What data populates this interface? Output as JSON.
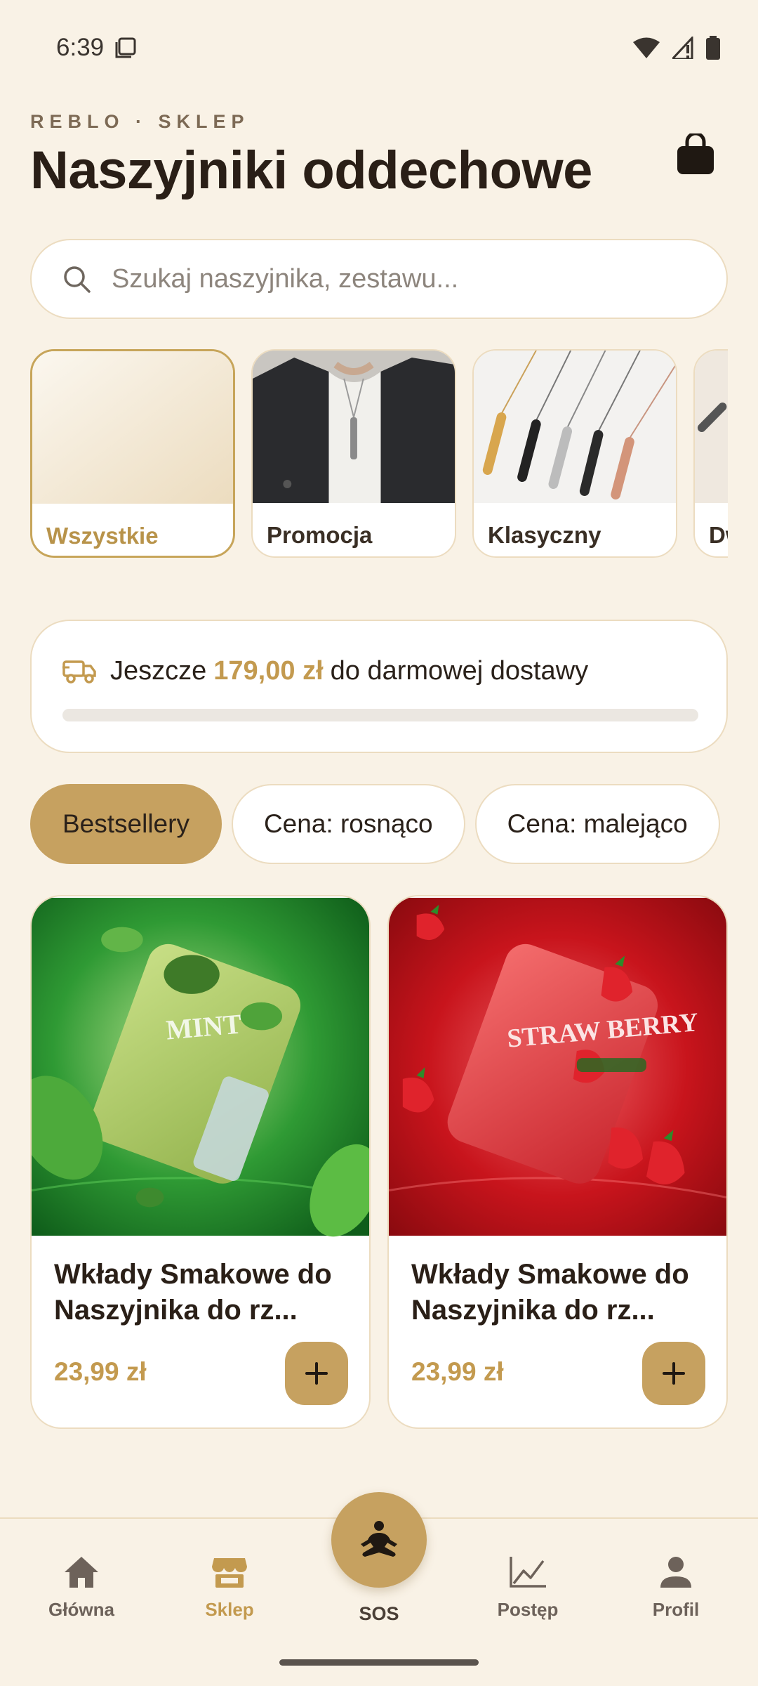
{
  "status_bar": {
    "time": "6:39"
  },
  "header": {
    "overline": "REBLO · SKLEP",
    "title": "Naszyjniki oddechowe"
  },
  "search": {
    "placeholder": "Szukaj naszyjnika, zestawu..."
  },
  "categories": [
    {
      "label": "Wszystkie",
      "active": true
    },
    {
      "label": "Promocja",
      "active": false
    },
    {
      "label": "Klasyczny",
      "active": false
    },
    {
      "label": "Dw",
      "active": false
    }
  ],
  "shipping": {
    "text_before": "Jeszcze",
    "amount": "179,00 zł",
    "text_after": "do darmowej dostawy",
    "progress": 0.0
  },
  "sort_chips": [
    {
      "label": "Bestsellery",
      "active": true
    },
    {
      "label": "Cena: rosnąco",
      "active": false
    },
    {
      "label": "Cena: malejąco",
      "active": false
    }
  ],
  "products": [
    {
      "name": "Wkłady Smakowe do Naszyjnika do rz...",
      "price": "23,99 zł",
      "image_text": "MINT"
    },
    {
      "name": "Wkłady Smakowe do Naszyjnika do rz...",
      "price": "23,99 zł",
      "image_text": "STRAW BERRY"
    }
  ],
  "nav": {
    "home": "Główna",
    "shop": "Sklep",
    "sos": "SOS",
    "progress": "Postęp",
    "profile": "Profil"
  },
  "colors": {
    "accent": "#c6a160",
    "background": "#f9f2e6",
    "border": "#ecdcc0"
  }
}
